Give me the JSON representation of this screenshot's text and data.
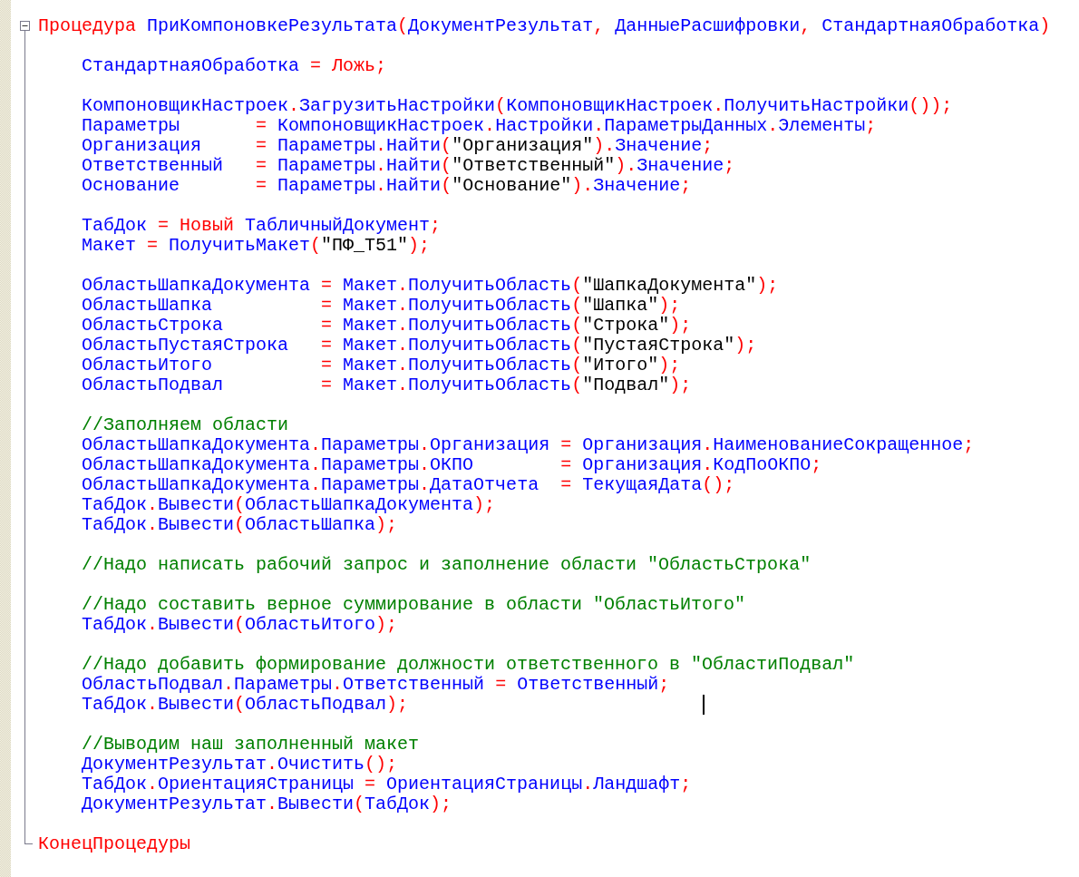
{
  "procedure": {
    "expanded": true,
    "header": [
      {
        "kind": "kw",
        "text": "Процедура"
      },
      {
        "kind": "id",
        "text": " ПриКомпоновкеРезультата"
      },
      {
        "kind": "op",
        "text": "("
      },
      {
        "kind": "id",
        "text": "ДокументРезультат"
      },
      {
        "kind": "op",
        "text": ","
      },
      {
        "kind": "id",
        "text": " ДанныеРасшифровки"
      },
      {
        "kind": "op",
        "text": ","
      },
      {
        "kind": "id",
        "text": " СтандартнаяОбработка"
      },
      {
        "kind": "op",
        "text": ")"
      }
    ],
    "body": [
      {
        "kind": "blank"
      },
      {
        "kind": "code",
        "tokens": [
          {
            "kind": "id",
            "text": "СтандартнаяОбработка"
          },
          {
            "kind": "op",
            "text": " = "
          },
          {
            "kind": "kw",
            "text": "Ложь"
          },
          {
            "kind": "op",
            "text": ";"
          }
        ]
      },
      {
        "kind": "blank"
      },
      {
        "kind": "code",
        "tokens": [
          {
            "kind": "id",
            "text": "КомпоновщикНастроек"
          },
          {
            "kind": "op",
            "text": "."
          },
          {
            "kind": "id",
            "text": "ЗагрузитьНастройки"
          },
          {
            "kind": "op",
            "text": "("
          },
          {
            "kind": "id",
            "text": "КомпоновщикНастроек"
          },
          {
            "kind": "op",
            "text": "."
          },
          {
            "kind": "id",
            "text": "ПолучитьНастройки"
          },
          {
            "kind": "op",
            "text": "());"
          }
        ]
      },
      {
        "kind": "code",
        "tokens": [
          {
            "kind": "id",
            "text": "Параметры"
          },
          {
            "kind": "op",
            "text": "       = "
          },
          {
            "kind": "id",
            "text": "КомпоновщикНастроек"
          },
          {
            "kind": "op",
            "text": "."
          },
          {
            "kind": "id",
            "text": "Настройки"
          },
          {
            "kind": "op",
            "text": "."
          },
          {
            "kind": "id",
            "text": "ПараметрыДанных"
          },
          {
            "kind": "op",
            "text": "."
          },
          {
            "kind": "id",
            "text": "Элементы"
          },
          {
            "kind": "op",
            "text": ";"
          }
        ]
      },
      {
        "kind": "code",
        "tokens": [
          {
            "kind": "id",
            "text": "Организация"
          },
          {
            "kind": "op",
            "text": "     = "
          },
          {
            "kind": "id",
            "text": "Параметры"
          },
          {
            "kind": "op",
            "text": "."
          },
          {
            "kind": "id",
            "text": "Найти"
          },
          {
            "kind": "op",
            "text": "("
          },
          {
            "kind": "str",
            "text": "\"Организация\""
          },
          {
            "kind": "op",
            "text": ")."
          },
          {
            "kind": "id",
            "text": "Значение"
          },
          {
            "kind": "op",
            "text": ";"
          }
        ]
      },
      {
        "kind": "code",
        "tokens": [
          {
            "kind": "id",
            "text": "Ответственный"
          },
          {
            "kind": "op",
            "text": "   = "
          },
          {
            "kind": "id",
            "text": "Параметры"
          },
          {
            "kind": "op",
            "text": "."
          },
          {
            "kind": "id",
            "text": "Найти"
          },
          {
            "kind": "op",
            "text": "("
          },
          {
            "kind": "str",
            "text": "\"Ответственный\""
          },
          {
            "kind": "op",
            "text": ")."
          },
          {
            "kind": "id",
            "text": "Значение"
          },
          {
            "kind": "op",
            "text": ";"
          }
        ]
      },
      {
        "kind": "code",
        "tokens": [
          {
            "kind": "id",
            "text": "Основание"
          },
          {
            "kind": "op",
            "text": "       = "
          },
          {
            "kind": "id",
            "text": "Параметры"
          },
          {
            "kind": "op",
            "text": "."
          },
          {
            "kind": "id",
            "text": "Найти"
          },
          {
            "kind": "op",
            "text": "("
          },
          {
            "kind": "str",
            "text": "\"Основание\""
          },
          {
            "kind": "op",
            "text": ")."
          },
          {
            "kind": "id",
            "text": "Значение"
          },
          {
            "kind": "op",
            "text": ";"
          }
        ]
      },
      {
        "kind": "blank"
      },
      {
        "kind": "code",
        "tokens": [
          {
            "kind": "id",
            "text": "ТабДок"
          },
          {
            "kind": "op",
            "text": " = "
          },
          {
            "kind": "kw",
            "text": "Новый"
          },
          {
            "kind": "id",
            "text": " ТабличныйДокумент"
          },
          {
            "kind": "op",
            "text": ";"
          }
        ]
      },
      {
        "kind": "code",
        "tokens": [
          {
            "kind": "id",
            "text": "Макет"
          },
          {
            "kind": "op",
            "text": " = "
          },
          {
            "kind": "id",
            "text": "ПолучитьМакет"
          },
          {
            "kind": "op",
            "text": "("
          },
          {
            "kind": "str",
            "text": "\"ПФ_Т51\""
          },
          {
            "kind": "op",
            "text": ");"
          }
        ]
      },
      {
        "kind": "blank"
      },
      {
        "kind": "code",
        "tokens": [
          {
            "kind": "id",
            "text": "ОбластьШапкаДокумента"
          },
          {
            "kind": "op",
            "text": " = "
          },
          {
            "kind": "id",
            "text": "Макет"
          },
          {
            "kind": "op",
            "text": "."
          },
          {
            "kind": "id",
            "text": "ПолучитьОбласть"
          },
          {
            "kind": "op",
            "text": "("
          },
          {
            "kind": "str",
            "text": "\"ШапкаДокумента\""
          },
          {
            "kind": "op",
            "text": ");"
          }
        ]
      },
      {
        "kind": "code",
        "tokens": [
          {
            "kind": "id",
            "text": "ОбластьШапка"
          },
          {
            "kind": "op",
            "text": "          = "
          },
          {
            "kind": "id",
            "text": "Макет"
          },
          {
            "kind": "op",
            "text": "."
          },
          {
            "kind": "id",
            "text": "ПолучитьОбласть"
          },
          {
            "kind": "op",
            "text": "("
          },
          {
            "kind": "str",
            "text": "\"Шапка\""
          },
          {
            "kind": "op",
            "text": ");"
          }
        ]
      },
      {
        "kind": "code",
        "tokens": [
          {
            "kind": "id",
            "text": "ОбластьСтрока"
          },
          {
            "kind": "op",
            "text": "         = "
          },
          {
            "kind": "id",
            "text": "Макет"
          },
          {
            "kind": "op",
            "text": "."
          },
          {
            "kind": "id",
            "text": "ПолучитьОбласть"
          },
          {
            "kind": "op",
            "text": "("
          },
          {
            "kind": "str",
            "text": "\"Строка\""
          },
          {
            "kind": "op",
            "text": ");"
          }
        ]
      },
      {
        "kind": "code",
        "tokens": [
          {
            "kind": "id",
            "text": "ОбластьПустаяСтрока"
          },
          {
            "kind": "op",
            "text": "   = "
          },
          {
            "kind": "id",
            "text": "Макет"
          },
          {
            "kind": "op",
            "text": "."
          },
          {
            "kind": "id",
            "text": "ПолучитьОбласть"
          },
          {
            "kind": "op",
            "text": "("
          },
          {
            "kind": "str",
            "text": "\"ПустаяСтрока\""
          },
          {
            "kind": "op",
            "text": ");"
          }
        ]
      },
      {
        "kind": "code",
        "tokens": [
          {
            "kind": "id",
            "text": "ОбластьИтого"
          },
          {
            "kind": "op",
            "text": "          = "
          },
          {
            "kind": "id",
            "text": "Макет"
          },
          {
            "kind": "op",
            "text": "."
          },
          {
            "kind": "id",
            "text": "ПолучитьОбласть"
          },
          {
            "kind": "op",
            "text": "("
          },
          {
            "kind": "str",
            "text": "\"Итого\""
          },
          {
            "kind": "op",
            "text": ");"
          }
        ]
      },
      {
        "kind": "code",
        "tokens": [
          {
            "kind": "id",
            "text": "ОбластьПодвал"
          },
          {
            "kind": "op",
            "text": "         = "
          },
          {
            "kind": "id",
            "text": "Макет"
          },
          {
            "kind": "op",
            "text": "."
          },
          {
            "kind": "id",
            "text": "ПолучитьОбласть"
          },
          {
            "kind": "op",
            "text": "("
          },
          {
            "kind": "str",
            "text": "\"Подвал\""
          },
          {
            "kind": "op",
            "text": ");"
          }
        ]
      },
      {
        "kind": "blank"
      },
      {
        "kind": "code",
        "tokens": [
          {
            "kind": "cm",
            "text": "//Заполняем области"
          }
        ]
      },
      {
        "kind": "code",
        "tokens": [
          {
            "kind": "id",
            "text": "ОбластьШапкаДокумента"
          },
          {
            "kind": "op",
            "text": "."
          },
          {
            "kind": "id",
            "text": "Параметры"
          },
          {
            "kind": "op",
            "text": "."
          },
          {
            "kind": "id",
            "text": "Организация"
          },
          {
            "kind": "op",
            "text": " = "
          },
          {
            "kind": "id",
            "text": "Организация"
          },
          {
            "kind": "op",
            "text": "."
          },
          {
            "kind": "id",
            "text": "НаименованиеСокращенное"
          },
          {
            "kind": "op",
            "text": ";"
          }
        ]
      },
      {
        "kind": "code",
        "tokens": [
          {
            "kind": "id",
            "text": "ОбластьШапкаДокумента"
          },
          {
            "kind": "op",
            "text": "."
          },
          {
            "kind": "id",
            "text": "Параметры"
          },
          {
            "kind": "op",
            "text": "."
          },
          {
            "kind": "id",
            "text": "ОКПО"
          },
          {
            "kind": "op",
            "text": "        = "
          },
          {
            "kind": "id",
            "text": "Организация"
          },
          {
            "kind": "op",
            "text": "."
          },
          {
            "kind": "id",
            "text": "КодПоОКПО"
          },
          {
            "kind": "op",
            "text": ";"
          }
        ]
      },
      {
        "kind": "code",
        "tokens": [
          {
            "kind": "id",
            "text": "ОбластьШапкаДокумента"
          },
          {
            "kind": "op",
            "text": "."
          },
          {
            "kind": "id",
            "text": "Параметры"
          },
          {
            "kind": "op",
            "text": "."
          },
          {
            "kind": "id",
            "text": "ДатаОтчета"
          },
          {
            "kind": "op",
            "text": "  = "
          },
          {
            "kind": "id",
            "text": "ТекущаяДата"
          },
          {
            "kind": "op",
            "text": "();"
          }
        ]
      },
      {
        "kind": "code",
        "tokens": [
          {
            "kind": "id",
            "text": "ТабДок"
          },
          {
            "kind": "op",
            "text": "."
          },
          {
            "kind": "id",
            "text": "Вывести"
          },
          {
            "kind": "op",
            "text": "("
          },
          {
            "kind": "id",
            "text": "ОбластьШапкаДокумента"
          },
          {
            "kind": "op",
            "text": ");"
          }
        ]
      },
      {
        "kind": "code",
        "tokens": [
          {
            "kind": "id",
            "text": "ТабДок"
          },
          {
            "kind": "op",
            "text": "."
          },
          {
            "kind": "id",
            "text": "Вывести"
          },
          {
            "kind": "op",
            "text": "("
          },
          {
            "kind": "id",
            "text": "ОбластьШапка"
          },
          {
            "kind": "op",
            "text": ");"
          }
        ]
      },
      {
        "kind": "blank"
      },
      {
        "kind": "code",
        "tokens": [
          {
            "kind": "cm",
            "text": "//Надо написать рабочий запрос и заполнение области \"ОбластьСтрока\""
          }
        ]
      },
      {
        "kind": "blank"
      },
      {
        "kind": "code",
        "tokens": [
          {
            "kind": "cm",
            "text": "//Надо составить верное суммирование в области \"ОбластьИтого\""
          }
        ]
      },
      {
        "kind": "code",
        "tokens": [
          {
            "kind": "id",
            "text": "ТабДок"
          },
          {
            "kind": "op",
            "text": "."
          },
          {
            "kind": "id",
            "text": "Вывести"
          },
          {
            "kind": "op",
            "text": "("
          },
          {
            "kind": "id",
            "text": "ОбластьИтого"
          },
          {
            "kind": "op",
            "text": ");"
          }
        ]
      },
      {
        "kind": "blank"
      },
      {
        "kind": "code",
        "tokens": [
          {
            "kind": "cm",
            "text": "//Надо добавить формирование должности ответственного в \"ОбластиПодвал\""
          }
        ]
      },
      {
        "kind": "code",
        "tokens": [
          {
            "kind": "id",
            "text": "ОбластьПодвал"
          },
          {
            "kind": "op",
            "text": "."
          },
          {
            "kind": "id",
            "text": "Параметры"
          },
          {
            "kind": "op",
            "text": "."
          },
          {
            "kind": "id",
            "text": "Ответственный"
          },
          {
            "kind": "op",
            "text": " = "
          },
          {
            "kind": "id",
            "text": "Ответственный"
          },
          {
            "kind": "op",
            "text": ";"
          }
        ]
      },
      {
        "kind": "code",
        "tokens": [
          {
            "kind": "id",
            "text": "ТабДок"
          },
          {
            "kind": "op",
            "text": "."
          },
          {
            "kind": "id",
            "text": "Вывести"
          },
          {
            "kind": "op",
            "text": "("
          },
          {
            "kind": "id",
            "text": "ОбластьПодвал"
          },
          {
            "kind": "op",
            "text": ");"
          }
        ]
      },
      {
        "kind": "blank"
      },
      {
        "kind": "code",
        "tokens": [
          {
            "kind": "cm",
            "text": "//Выводим наш заполненный макет"
          }
        ]
      },
      {
        "kind": "code",
        "tokens": [
          {
            "kind": "id",
            "text": "ДокументРезультат"
          },
          {
            "kind": "op",
            "text": "."
          },
          {
            "kind": "id",
            "text": "Очистить"
          },
          {
            "kind": "op",
            "text": "();"
          }
        ]
      },
      {
        "kind": "code",
        "tokens": [
          {
            "kind": "id",
            "text": "ТабДок"
          },
          {
            "kind": "op",
            "text": "."
          },
          {
            "kind": "id",
            "text": "ОриентацияСтраницы"
          },
          {
            "kind": "op",
            "text": " = "
          },
          {
            "kind": "id",
            "text": "ОриентацияСтраницы"
          },
          {
            "kind": "op",
            "text": "."
          },
          {
            "kind": "id",
            "text": "Ландшафт"
          },
          {
            "kind": "op",
            "text": ";"
          }
        ]
      },
      {
        "kind": "code",
        "tokens": [
          {
            "kind": "id",
            "text": "ДокументРезультат"
          },
          {
            "kind": "op",
            "text": "."
          },
          {
            "kind": "id",
            "text": "Вывести"
          },
          {
            "kind": "op",
            "text": "("
          },
          {
            "kind": "id",
            "text": "ТабДок"
          },
          {
            "kind": "op",
            "text": ");"
          }
        ]
      },
      {
        "kind": "blank"
      }
    ],
    "footer": [
      {
        "kind": "kw",
        "text": "КонецПроцедуры"
      }
    ]
  }
}
